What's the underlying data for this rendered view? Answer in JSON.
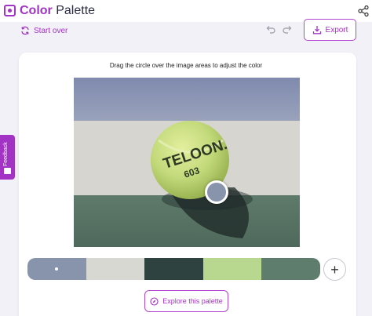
{
  "app": {
    "title_accent": "Color",
    "title_rest": " Palette",
    "brand_color": "#a233c4",
    "icons": [
      "color-palette-logo-icon",
      "share-icon"
    ]
  },
  "toolbar": {
    "start_over_label": "Start over",
    "export_label": "Export",
    "icons": [
      "refresh-icon",
      "undo-icon",
      "redo-icon",
      "download-icon"
    ]
  },
  "editor": {
    "instruction": "Drag the circle over the image areas to adjust the color",
    "image_subject": "tennis ball on court line",
    "ball_text_1": "TELOON.",
    "ball_text_2": "603",
    "picker_color": "#8893ac"
  },
  "palette": {
    "swatches": [
      {
        "color": "#8893ac",
        "selected": true
      },
      {
        "color": "#d8d8d3",
        "selected": false
      },
      {
        "color": "#2e4340",
        "selected": false
      },
      {
        "color": "#b9d88f",
        "selected": false
      },
      {
        "color": "#5f7d6c",
        "selected": false
      }
    ],
    "add_icon": "plus-icon",
    "add_symbol": "+"
  },
  "actions": {
    "explore_label": "Explore this palette",
    "explore_icon": "compass-icon"
  },
  "feedback": {
    "label": "Feedback"
  }
}
